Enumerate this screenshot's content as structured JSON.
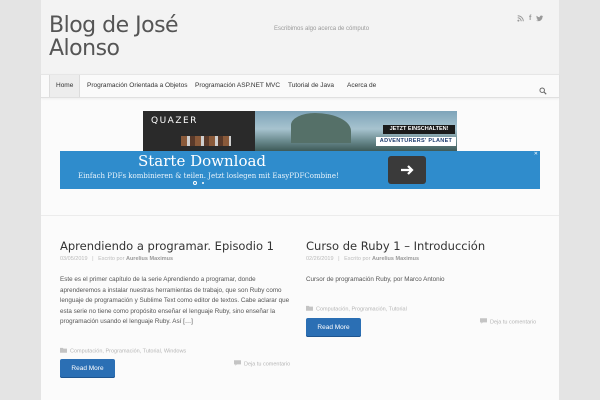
{
  "site": {
    "title": "Blog de José Alonso",
    "tagline": "Escribimos algo acerca de cómputo"
  },
  "social": [
    "rss-icon",
    "facebook-icon",
    "twitter-icon"
  ],
  "nav": {
    "items": [
      {
        "label": "Home",
        "active": true
      },
      {
        "label": "Programación Orientada a Objetos"
      },
      {
        "label": "Programación ASP.NET MVC"
      },
      {
        "label": "Tutorial de Java"
      },
      {
        "label": "Acerca de"
      }
    ],
    "search_icon": "search-icon"
  },
  "ads": {
    "banner1": {
      "brand": "QUAZER",
      "cta": "JETZT EINSCHALTEN!",
      "brand2": "ADVENTURERS' PLANET"
    },
    "banner2": {
      "title": "Starte Download",
      "subtitle": "Einfach PDFs kombinieren & teilen. Jetzt loslegen mit EasyPDFCombine!",
      "dots": 2,
      "active_dot": 0
    }
  },
  "posts": [
    {
      "title": "Aprendiendo a programar. Episodio 1",
      "date": "03/05/2019",
      "by": "Escrito por",
      "author": "Aurelius Maximus",
      "excerpt": "Este es el primer capítulo de la serie Aprendiendo a programar, donde aprenderemos a instalar nuestras herramientas de trabajo, que son Ruby como lenguaje de programación y Sublime Text como editor de textos. Cabe aclarar que esta serie no tiene como propósito enseñar el lenguaje Ruby, sino enseñar la programación usando el lenguaje Ruby. Así […]",
      "categories": "Computación, Programación, Tutorial, Windows",
      "comments": "Deja tu comentario",
      "read_more": "Read More"
    },
    {
      "title": "Curso de Ruby 1 – Introducción",
      "date": "02/26/2019",
      "by": "Escrito por",
      "author": "Aurelius Maximus",
      "excerpt": "Cursor de programación Ruby, por Marco Antonio",
      "categories": "Computación, Programación, Tutorial",
      "comments": "Deja tu comentario",
      "read_more": "Read More"
    }
  ],
  "colors": {
    "accent": "#2b6fb4",
    "ad_blue": "#2f8ccc",
    "background": "#e4e4e4"
  }
}
